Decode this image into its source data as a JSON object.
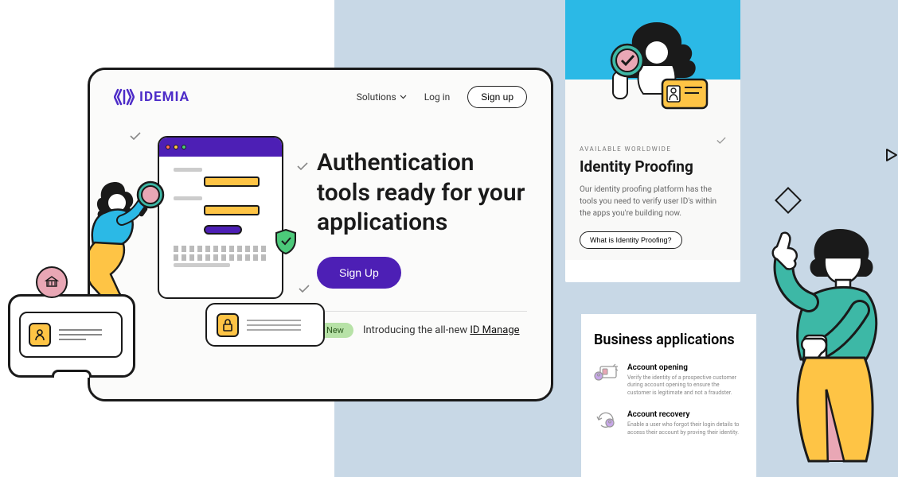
{
  "brand": "IDEMIA",
  "nav": {
    "solutions": "Solutions",
    "login": "Log in",
    "signup": "Sign up"
  },
  "hero": {
    "headline": "Authentication tools ready for your applications",
    "cta": "Sign Up",
    "badge": "New",
    "footer_prefix": "Introducing the all-new ",
    "footer_link": "ID Manage"
  },
  "card2": {
    "eyebrow": "AVAILABLE WORLDWIDE",
    "title": "Identity Proofing",
    "body": "Our identity proofing platform has the tools you need to verify user ID's within the apps you're building now.",
    "cta": "What is Identity Proofing?"
  },
  "card3": {
    "title": "Business applications",
    "items": [
      {
        "title": "Account opening",
        "body": "Verify the identity of a prospective customer during account opening to ensure the customer is legitimate and not a fraudster."
      },
      {
        "title": "Account recovery",
        "body": "Enable a user who forgot their login details to access their account by proving their identity."
      }
    ]
  }
}
